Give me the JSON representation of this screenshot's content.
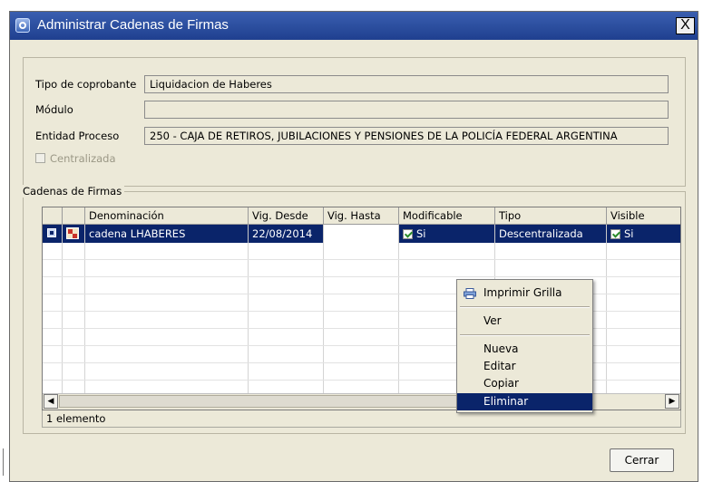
{
  "window": {
    "title": "Administrar Cadenas de Firmas",
    "close_label": "X"
  },
  "form": {
    "tipo_label": "Tipo de coprobante",
    "tipo_value": "Liquidacion de Haberes",
    "modulo_label": "Módulo",
    "modulo_value": "",
    "entidad_label": "Entidad Proceso",
    "entidad_value": "250 - CAJA DE RETIROS, JUBILACIONES Y PENSIONES DE LA POLICÍA FEDERAL ARGENTINA",
    "centralizada_label": "Centralizada",
    "centralizada_checked": false
  },
  "cadenas": {
    "legend": "Cadenas de Firmas",
    "columns": [
      "Denominación",
      "Vig. Desde",
      "Vig. Hasta",
      "Modificable",
      "Tipo",
      "Visible"
    ],
    "rows": [
      {
        "denominacion": "cadena LHABERES",
        "vig_desde": "22/08/2014",
        "vig_hasta": "",
        "modificable": "Si",
        "tipo": "Descentralizada",
        "visible": "Si"
      }
    ],
    "status": "1 elemento"
  },
  "context_menu": {
    "items": [
      "Imprimir Grilla",
      "Ver",
      "Nueva",
      "Editar",
      "Copiar",
      "Eliminar"
    ],
    "highlighted": "Eliminar"
  },
  "footer": {
    "close_button": "Cerrar"
  },
  "colors": {
    "title_bar": "#1f3f8f",
    "selection": "#0a246a",
    "dialog_bg": "#ECE9D8"
  }
}
